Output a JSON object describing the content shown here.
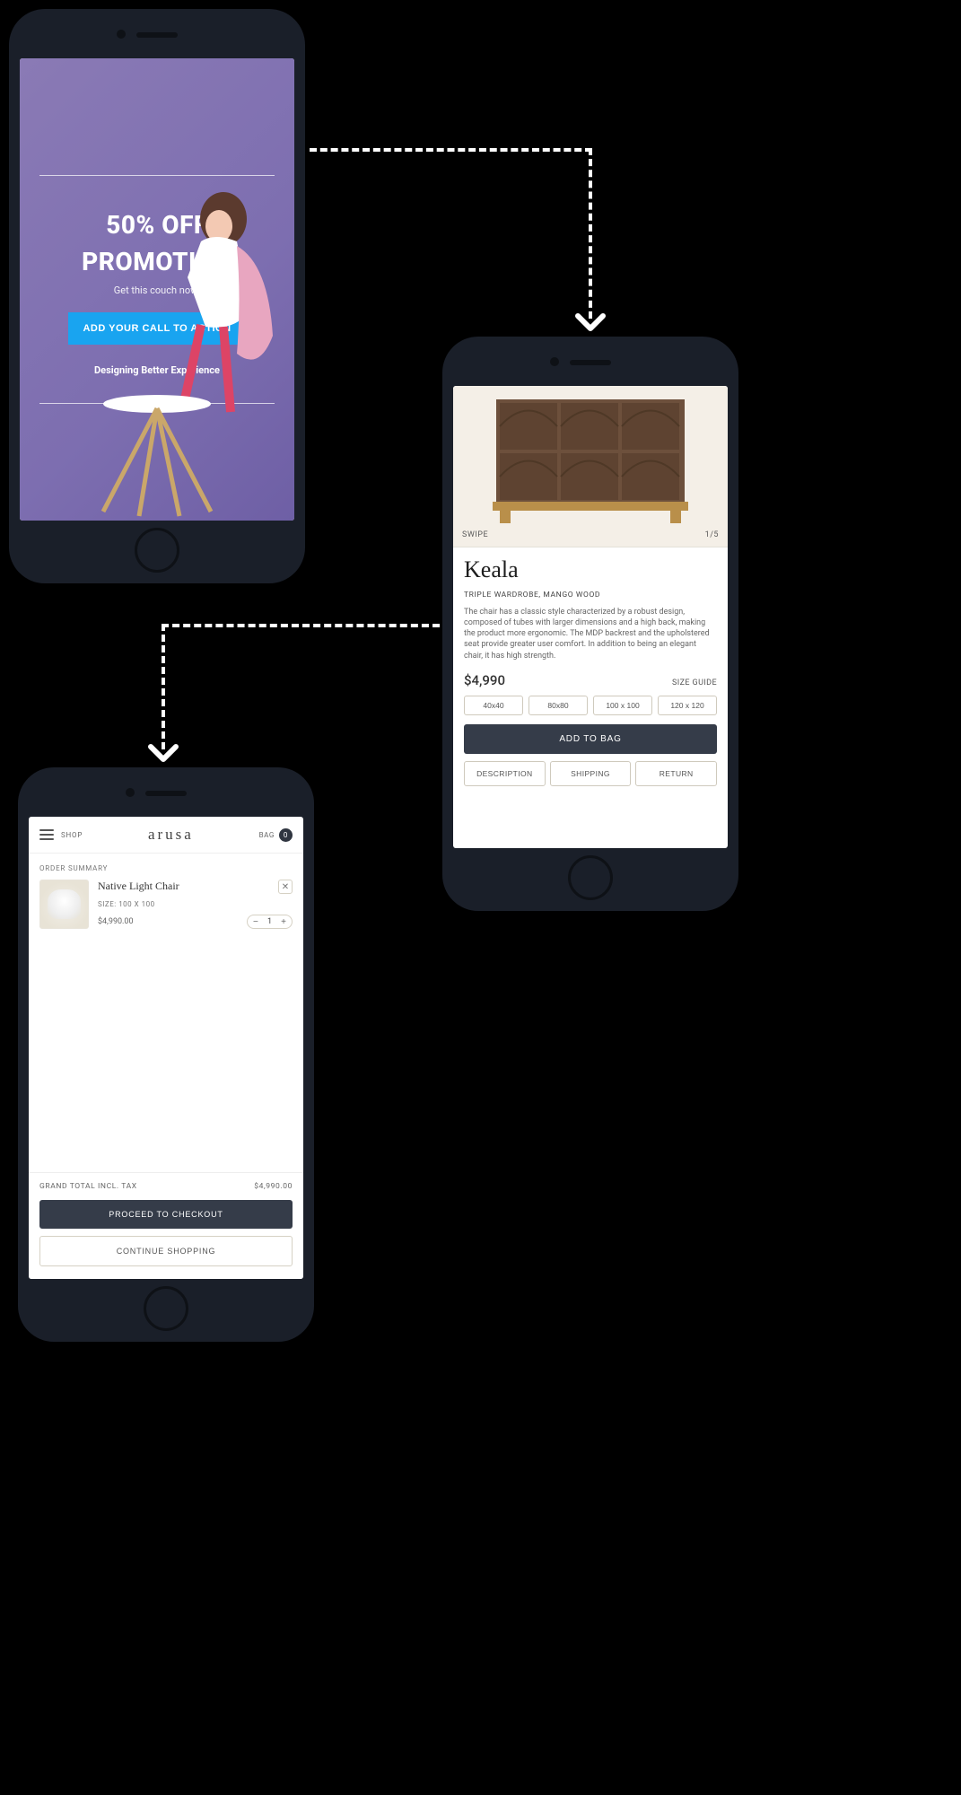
{
  "promo": {
    "title_line1": "50% OFF",
    "title_line2": "PROMOTION",
    "subtitle": "Get this couch now!",
    "cta": "ADD YOUR CALL TO ACTION",
    "tagline": "Designing Better Experience"
  },
  "product": {
    "swipe_label": "SWIPE",
    "image_index": "1/5",
    "name": "Keala",
    "subtitle": "TRIPLE WARDROBE, MANGO WOOD",
    "description": "The chair has a classic style characterized by a robust design, composed of tubes with larger dimensions and a high back, making the product more ergonomic. The MDP backrest and the upholstered seat provide greater user comfort. In addition to being an elegant chair, it has high strength.",
    "price": "$4,990",
    "size_guide": "SIZE GUIDE",
    "sizes": [
      "40x40",
      "80x80",
      "100 x 100",
      "120 x 120"
    ],
    "add_to_bag": "ADD TO BAG",
    "tabs": [
      "DESCRIPTION",
      "SHIPPING",
      "RETURN"
    ]
  },
  "cart": {
    "shop_link": "SHOP",
    "brand": "arusa",
    "bag_label": "BAG",
    "bag_count": "0",
    "order_summary": "ORDER SUMMARY",
    "item": {
      "name": "Native Light Chair",
      "size_label": "SIZE: 100 X 100",
      "price": "$4,990.00",
      "qty": "1"
    },
    "grand_label": "GRAND TOTAL INCL. TAX",
    "grand_value": "$4,990.00",
    "checkout": "PROCEED TO CHECKOUT",
    "continue": "CONTINUE SHOPPING"
  }
}
